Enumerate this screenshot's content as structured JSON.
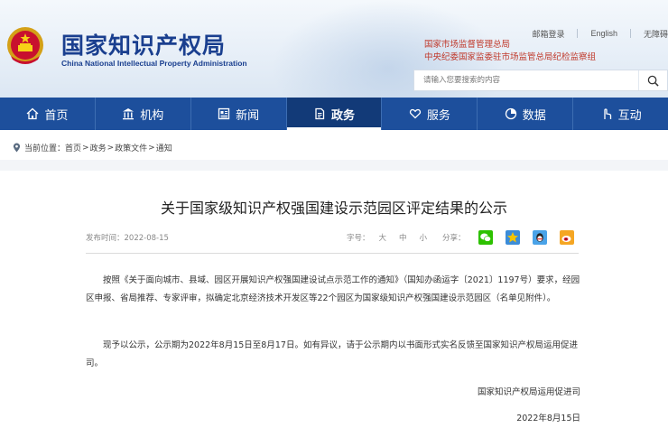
{
  "header": {
    "title_cn": "国家知识产权局",
    "title_en": "China National Intellectual Property Administration",
    "top_links": [
      "邮箱登录",
      "English",
      "无障碍"
    ],
    "org_links": [
      "国家市场监督管理总局",
      "中央纪委国家监委驻市场监管总局纪检监察组"
    ],
    "search_placeholder": "请输入您要搜索的内容"
  },
  "nav": {
    "items": [
      {
        "label": "首页",
        "icon": "home-icon"
      },
      {
        "label": "机构",
        "icon": "institution-icon"
      },
      {
        "label": "新闻",
        "icon": "news-icon"
      },
      {
        "label": "政务",
        "icon": "document-icon",
        "active": true
      },
      {
        "label": "服务",
        "icon": "heart-hand-icon"
      },
      {
        "label": "数据",
        "icon": "pie-chart-icon"
      },
      {
        "label": "互动",
        "icon": "hand-pointer-icon"
      }
    ]
  },
  "breadcrumb": {
    "prefix": "当前位置：",
    "items": [
      "首页",
      "政务",
      "政策文件",
      "通知"
    ],
    "separator": ">"
  },
  "article": {
    "title": "关于国家级知识产权强国建设示范园区评定结果的公示",
    "publish_label": "发布时间：2022-08-15",
    "font_label": "字号：",
    "font_sizes": [
      "大",
      "中",
      "小"
    ],
    "share_label": "分享：",
    "share_icons": [
      "wechat-icon",
      "qzone-icon",
      "qq-icon",
      "weibo-icon"
    ],
    "paragraph1": "按照《关于面向城市、县域、园区开展知识产权强国建设试点示范工作的通知》（国知办函运字〔2021〕1197号）要求，经园区申报、省局推荐、专家评审，拟确定北京经济技术开发区等22个园区为国家级知识产权强国建设示范园区（名单见附件）。",
    "paragraph2": "现予以公示，公示期为2022年8月15日至8月17日。如有异议，请于公示期内以书面形式实名反馈至国家知识产权局运用促进司。",
    "signature_org": "国家知识产权局运用促进司",
    "signature_date": "2022年8月15日"
  },
  "colors": {
    "nav_bg": "#1d4f9c",
    "nav_active": "#123a78",
    "title_blue": "#1a3f8f",
    "org_red": "#c0392b"
  }
}
